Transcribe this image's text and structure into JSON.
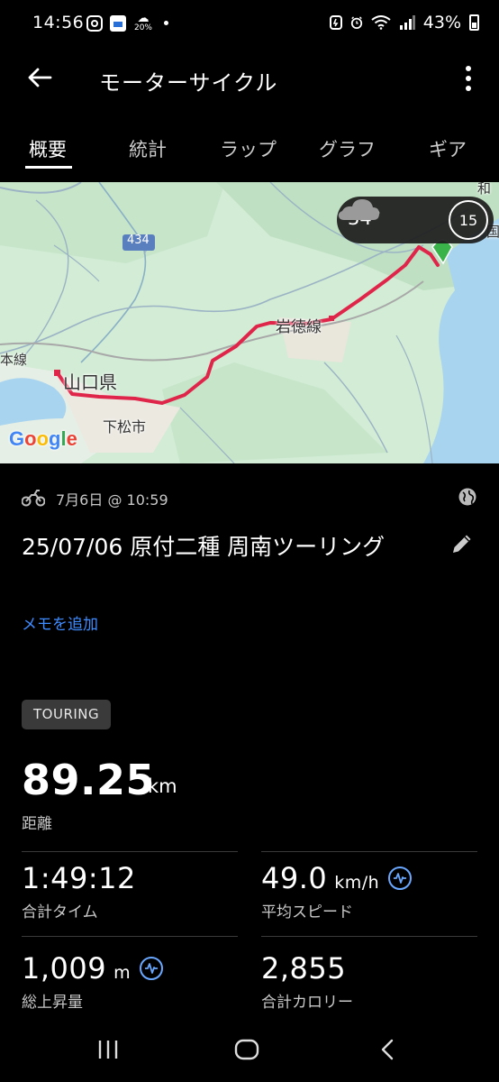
{
  "status_bar": {
    "time": "14:56",
    "weather_mini_temp": "20%",
    "battery": "43%",
    "icons": [
      "instagram-icon",
      "calendar-icon",
      "weather-icon",
      "dot-icon",
      "data-saver-icon",
      "alarm-icon",
      "wifi-icon",
      "signal-icon",
      "battery-icon"
    ]
  },
  "header": {
    "title": "モーターサイクル",
    "back_icon": "arrow-back-icon",
    "menu_icon": "more-vert-icon"
  },
  "tabs": [
    {
      "label": "概要",
      "active": true
    },
    {
      "label": "統計",
      "active": false
    },
    {
      "label": "ラップ",
      "active": false
    },
    {
      "label": "グラフ",
      "active": false
    },
    {
      "label": "ギア",
      "active": false
    }
  ],
  "map": {
    "labels": {
      "route_434": "434",
      "iwatoku_line": "岩徳線",
      "yamaguchi": "山口県",
      "kudamatsu": "下松市",
      "line_left": "本線",
      "corner_top": "和",
      "corner_right": "国"
    },
    "provider": "Google",
    "weather": {
      "temp": "34°",
      "icon": "cloud-icon"
    },
    "wind": "15",
    "route_color": "#e0254a"
  },
  "activity": {
    "date": "7月6日 @ 10:59",
    "title": "25/07/06 原付二種 周南ツーリング",
    "memo_link": "メモを追加",
    "tag": "TOURING",
    "sport_icon": "motorcycle-icon",
    "privacy_icon": "globe-icon",
    "edit_icon": "pencil-icon"
  },
  "stats": {
    "distance": {
      "value": "89.25",
      "unit": "km",
      "label": "距離"
    },
    "time": {
      "value": "1:49:12",
      "label": "合計タイム"
    },
    "avg_speed": {
      "value": "49.0",
      "unit": "km/h",
      "label": "平均スピード"
    },
    "elevation": {
      "value": "1,009",
      "unit": "m",
      "label": "総上昇量"
    },
    "calories": {
      "value": "2,855",
      "label": "合計カロリー"
    }
  },
  "colors": {
    "accent_blue": "#3f8cff",
    "tag_bg": "#3a3a3a"
  },
  "nav": {
    "recent": "recents-icon",
    "home": "home-icon",
    "back": "back-icon"
  }
}
